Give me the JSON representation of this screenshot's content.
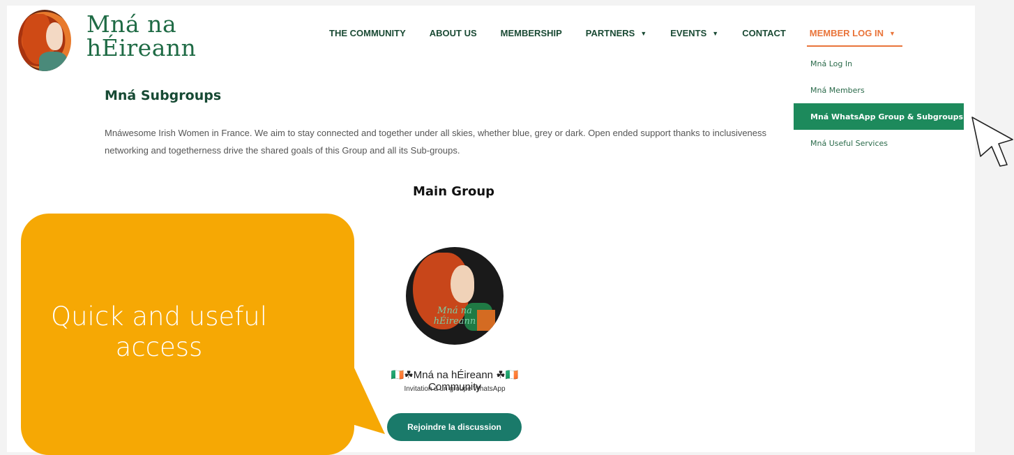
{
  "header": {
    "logo_line1": "Mná na",
    "logo_line2": "hÉireann"
  },
  "nav": {
    "items": [
      {
        "label": "THE COMMUNITY",
        "caret": false
      },
      {
        "label": "ABOUT US",
        "caret": false
      },
      {
        "label": "MEMBERSHIP",
        "caret": false
      },
      {
        "label": "PARTNERS",
        "caret": true
      },
      {
        "label": "EVENTS",
        "caret": true
      },
      {
        "label": "CONTACT",
        "caret": false
      },
      {
        "label": "MEMBER LOG IN",
        "caret": true,
        "active": true
      }
    ]
  },
  "dropdown": {
    "items": [
      {
        "label": "Mná Log In"
      },
      {
        "label": "Mná Members"
      },
      {
        "label": "Mná WhatsApp Group & Subgroups",
        "highlighted": true
      },
      {
        "label": "Mná Useful Services"
      }
    ]
  },
  "content": {
    "title": "Mná Subgroups",
    "description": "Mnáwesome Irish Women in France. We aim to stay connected and together under all skies, whether blue, grey or dark. Open ended support thanks to inclusiveness networking and togetherness drive the shared goals of this Group and all its Sub-groups.",
    "main_group_title": "Main Group",
    "avatar_text_line1": "Mná na",
    "avatar_text_line2": "hÉireann",
    "community_name": "🇮🇪☘Mná na hÉireann ☘🇮🇪 Community",
    "invite_text": "Invitation à un groupe WhatsApp",
    "join_button": "Rejoindre la discussion"
  },
  "callout": {
    "text_line1": "Quick and useful",
    "text_line2": "access"
  },
  "colors": {
    "brand_green": "#1f6b45",
    "accent_orange": "#e9743a",
    "highlight_green": "#1d8a5c",
    "button_teal": "#1a7a6a",
    "callout_orange": "#f6a804"
  }
}
